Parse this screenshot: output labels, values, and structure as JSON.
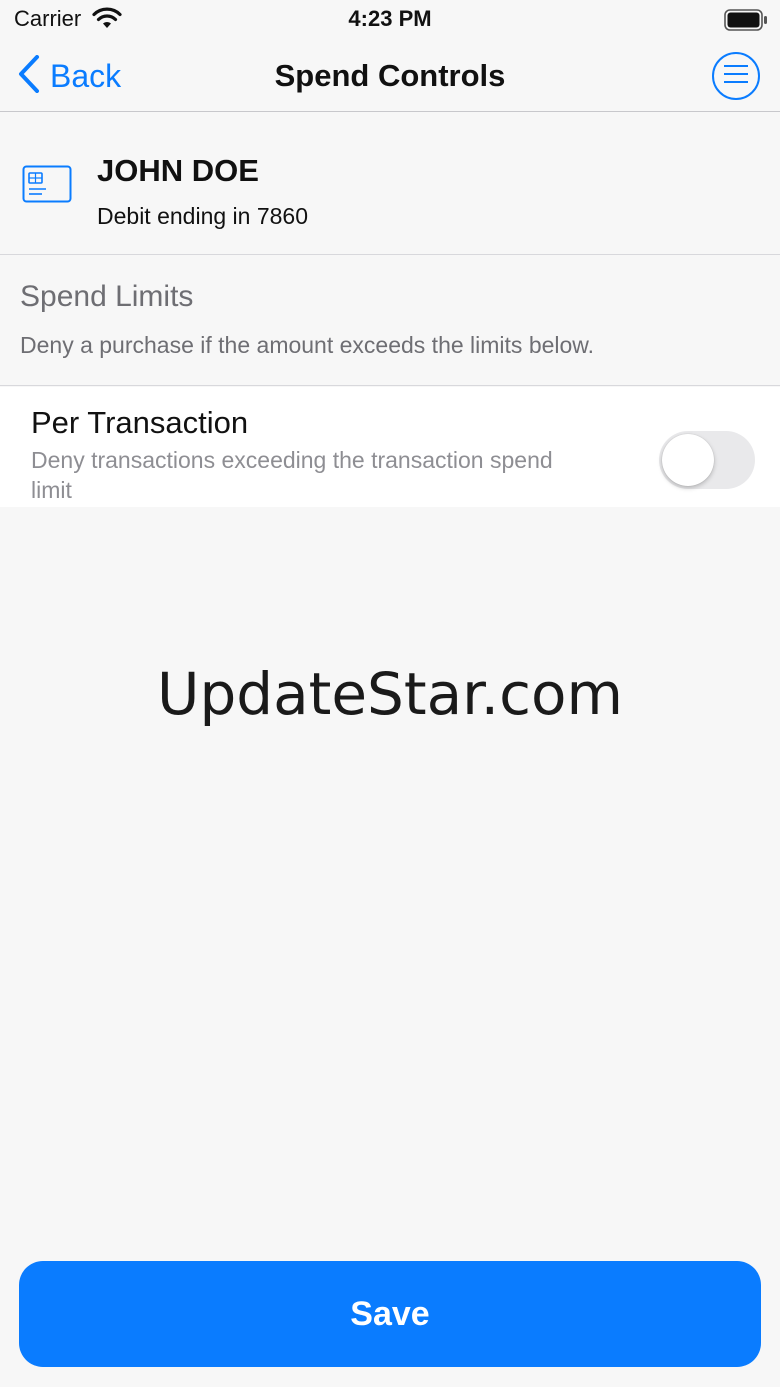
{
  "status_bar": {
    "carrier": "Carrier",
    "time": "4:23 PM"
  },
  "nav": {
    "back_label": "Back",
    "title": "Spend Controls",
    "menu_icon": "hamburger-circle-icon"
  },
  "card": {
    "icon": "card-icon",
    "name": "JOHN DOE",
    "subtitle": "Debit ending in 7860"
  },
  "spend_limits": {
    "title": "Spend Limits",
    "description": "Deny a purchase if the amount exceeds the limits below."
  },
  "per_transaction": {
    "title": "Per Transaction",
    "description": "Deny transactions exceeding the transaction spend limit",
    "enabled": false
  },
  "watermark": "UpdateStar.com",
  "save_label": "Save",
  "colors": {
    "accent": "#0a7cff",
    "background": "#f7f7f7",
    "secondary_text": "#8e8e93"
  }
}
